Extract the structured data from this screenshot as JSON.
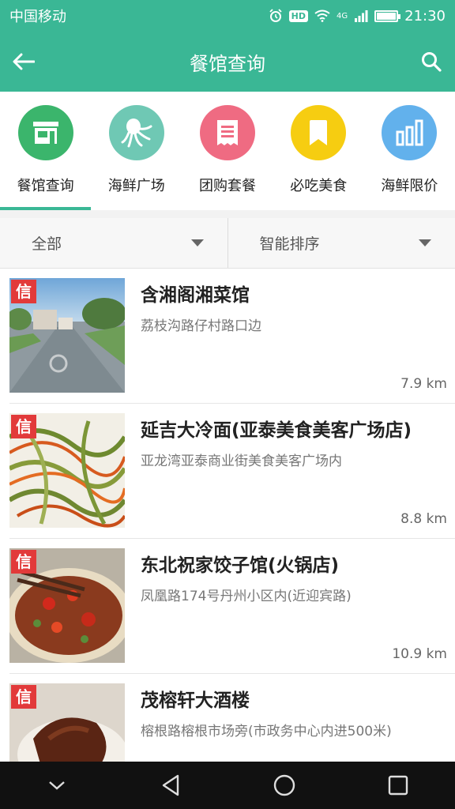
{
  "status_bar": {
    "carrier": "中国移动",
    "hd_badge": "HD",
    "signal_type": "4G",
    "time": "21:30",
    "battery_level": 0.9
  },
  "header": {
    "title": "餐馆查询",
    "back_icon": "back-arrow-icon",
    "search_icon": "search-icon"
  },
  "categories": [
    {
      "label": "餐馆查询",
      "icon": "store-icon",
      "color": "#3bb56c",
      "active": true
    },
    {
      "label": "海鲜广场",
      "icon": "octopus-icon",
      "color": "#6fc8b4",
      "active": false
    },
    {
      "label": "团购套餐",
      "icon": "receipt-icon",
      "color": "#ef6b82",
      "active": false
    },
    {
      "label": "必吃美食",
      "icon": "bookmark-icon",
      "color": "#f6cd11",
      "active": false
    },
    {
      "label": "海鲜限价",
      "icon": "bar-chart-icon",
      "color": "#62b1ec",
      "active": false
    }
  ],
  "colors": {
    "primary": "#3ab795",
    "active_underline": "#3ab795"
  },
  "filters": {
    "area": "全部",
    "sort": "智能排序"
  },
  "restaurants": [
    {
      "name": "含湘阁湘菜馆",
      "address": "荔枝沟路仔村路口边",
      "distance": "7.9 km",
      "badge": "信"
    },
    {
      "name": "延吉大冷面(亚泰美食美客广场店)",
      "address": "亚龙湾亚泰商业街美食美客广场内",
      "distance": "8.8 km",
      "badge": "信"
    },
    {
      "name": "东北祝家饺子馆(火锅店)",
      "address": "凤凰路174号丹州小区内(近迎宾路)",
      "distance": "10.9 km",
      "badge": "信"
    },
    {
      "name": "茂榕轩大酒楼",
      "address": "榕根路榕根市场旁(市政务中心内进500米)",
      "distance": "",
      "badge": "信"
    }
  ]
}
